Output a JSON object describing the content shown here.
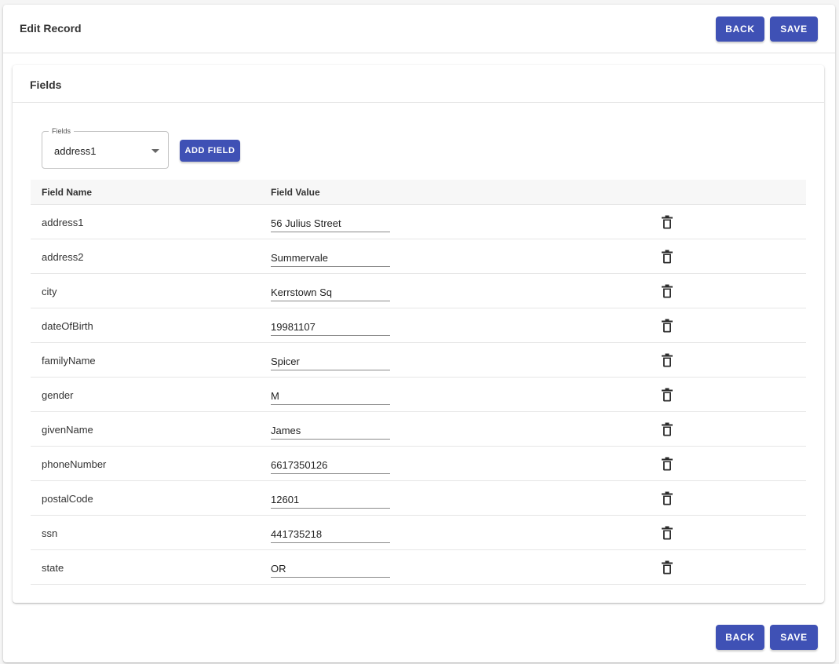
{
  "header": {
    "title": "Edit Record",
    "back_label": "BACK",
    "save_label": "SAVE"
  },
  "fields_card": {
    "title": "Fields",
    "select": {
      "legend": "Fields",
      "value": "address1"
    },
    "add_field_label": "ADD FIELD"
  },
  "table": {
    "columns": [
      "Field Name",
      "Field Value"
    ],
    "rows": [
      {
        "name": "address1",
        "value": "56 Julius Street"
      },
      {
        "name": "address2",
        "value": "Summervale"
      },
      {
        "name": "city",
        "value": "Kerrstown Sq"
      },
      {
        "name": "dateOfBirth",
        "value": "19981107"
      },
      {
        "name": "familyName",
        "value": "Spicer"
      },
      {
        "name": "gender",
        "value": "M"
      },
      {
        "name": "givenName",
        "value": "James"
      },
      {
        "name": "phoneNumber",
        "value": "6617350126"
      },
      {
        "name": "postalCode",
        "value": "12601"
      },
      {
        "name": "ssn",
        "value": "441735218"
      },
      {
        "name": "state",
        "value": "OR"
      }
    ],
    "row_action_icon": "trash-icon"
  },
  "footer": {
    "back_label": "BACK",
    "save_label": "SAVE"
  },
  "colors": {
    "primary": "#3f51b5",
    "background": "#f5f5f5"
  }
}
